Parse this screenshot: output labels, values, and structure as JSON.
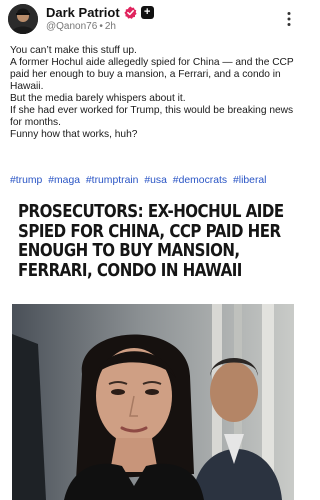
{
  "author": {
    "display_name": "Dark Patriot",
    "handle": "@Qanon76",
    "time": "2h",
    "plus_symbol": "+"
  },
  "post": {
    "lines": [
      "You can’t make this stuff up.",
      "A former Hochul aide allegedly spied for China — and the CCP paid her enough to buy a mansion, a Ferrari, and a condo in Hawaii.",
      "But the media barely whispers about it.",
      "If she had ever worked for Trump, this would be breaking news for months.",
      "Funny how that works, huh?"
    ],
    "hashtags": [
      "#trump",
      "#maga",
      "#trumptrain",
      "#usa",
      "#democrats",
      "#liberal"
    ]
  },
  "media": {
    "headline": "PROSECUTORS: EX-HOCHUL AIDE SPIED FOR CHINA, CCP PAID HER ENOUGH TO BUY MANSION, FERRARI, CONDO IN HAWAII"
  },
  "icons": {
    "more": "more-options-icon",
    "verified": "verified-badge-icon",
    "plus": "plus-badge-icon"
  },
  "colors": {
    "hashtag": "#2a55c5",
    "verified_badge": "#e0245e",
    "text": "#1a1a1a",
    "meta": "#777777"
  }
}
